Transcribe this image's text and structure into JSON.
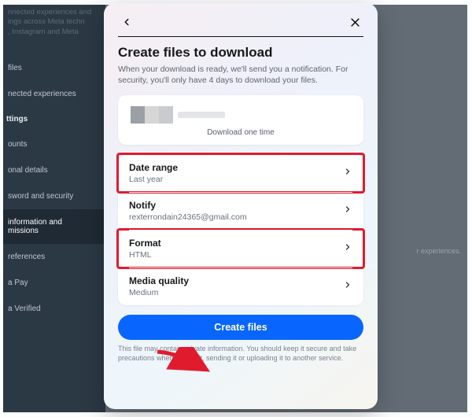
{
  "background": {
    "header_lines": "nnected experiences and\nings across Meta techn\n, Instagram and Meta",
    "sidebar": {
      "items": [
        {
          "label": "files",
          "type": "item"
        },
        {
          "label": "nected experiences",
          "type": "item"
        },
        {
          "label": "ttings",
          "type": "heading"
        },
        {
          "label": "ounts",
          "type": "item"
        },
        {
          "label": "onal details",
          "type": "item"
        },
        {
          "label": "sword and security",
          "type": "item"
        },
        {
          "label": "information and\nmissions",
          "type": "item",
          "active": true
        },
        {
          "label": "references",
          "type": "item"
        },
        {
          "label": "a Pay",
          "type": "item"
        },
        {
          "label": "a Verified",
          "type": "item"
        }
      ]
    },
    "right_faint": "r experiences."
  },
  "modal": {
    "title": "Create files to download",
    "subtitle": "When your download is ready, we'll send you a notification. For security, you'll only have 4 days to download your files.",
    "preview_caption": "Download one time",
    "options": [
      {
        "key": "date_range",
        "label": "Date range",
        "value": "Last year",
        "highlighted": true
      },
      {
        "key": "notify",
        "label": "Notify",
        "value": "rexterrondain24365@gmail.com",
        "highlighted": false
      },
      {
        "key": "format",
        "label": "Format",
        "value": "HTML",
        "highlighted": true
      },
      {
        "key": "media_quality",
        "label": "Media quality",
        "value": "Medium",
        "highlighted": false
      }
    ],
    "cta_label": "Create files",
    "disclaimer": "This file may contain private information. You should keep it secure and take precautions when storing it, sending it or uploading it to another service."
  }
}
